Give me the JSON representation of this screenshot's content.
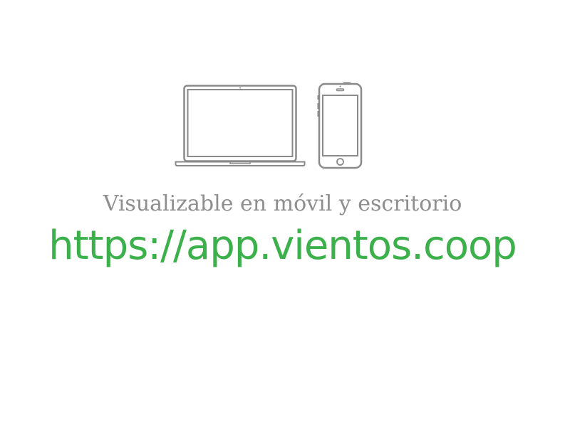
{
  "tagline": "Visualizable en móvil y escritorio",
  "url": "https://app.vientos.coop",
  "icons": {
    "laptop": "laptop-icon",
    "phone": "smartphone-icon"
  },
  "colors": {
    "accent": "#3cb04a",
    "text_muted": "#8e8e8e",
    "icon_stroke": "#8a8a8a",
    "background": "#ffffff"
  }
}
